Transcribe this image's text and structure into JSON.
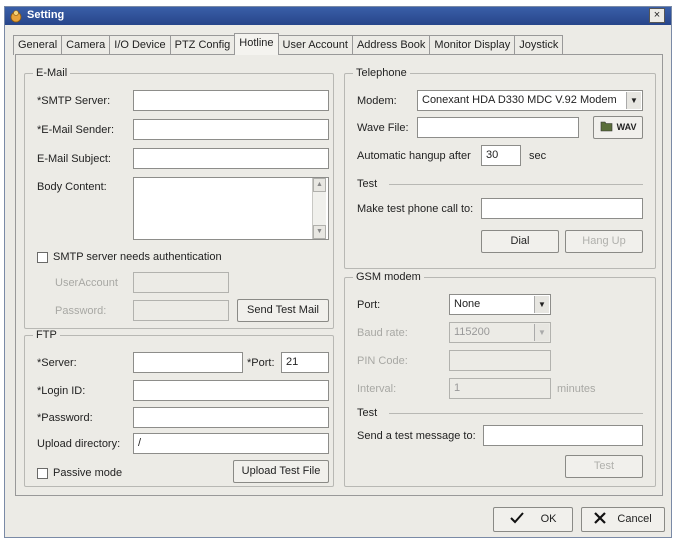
{
  "window": {
    "title": "Setting",
    "close_glyph": "×"
  },
  "tabs": [
    {
      "label": "General"
    },
    {
      "label": "Camera"
    },
    {
      "label": "I/O Device"
    },
    {
      "label": "PTZ Config"
    },
    {
      "label": "Hotline"
    },
    {
      "label": "User Account"
    },
    {
      "label": "Address Book"
    },
    {
      "label": "Monitor Display"
    },
    {
      "label": "Joystick"
    }
  ],
  "active_tab": "Hotline",
  "email": {
    "legend": "E-Mail",
    "smtp_server_label": "*SMTP Server:",
    "smtp_server_value": "",
    "sender_label": "*E-Mail Sender:",
    "sender_value": "",
    "subject_label": "E-Mail Subject:",
    "subject_value": "",
    "body_label": "Body Content:",
    "body_value": "",
    "auth_checkbox_label": "SMTP server needs authentication",
    "auth_checked": false,
    "useraccount_label": "UserAccount",
    "useraccount_value": "",
    "password_label": "Password:",
    "password_value": "",
    "send_test_mail": "Send Test Mail"
  },
  "ftp": {
    "legend": "FTP",
    "server_label": "*Server:",
    "server_value": "",
    "port_label": "*Port:",
    "port_value": "21",
    "login_label": "*Login ID:",
    "login_value": "",
    "password_label": "*Password:",
    "password_value": "",
    "upload_dir_label": "Upload directory:",
    "upload_dir_value": "/",
    "passive_label": "Passive mode",
    "passive_checked": false,
    "upload_test_file": "Upload Test File"
  },
  "telephone": {
    "legend": "Telephone",
    "modem_label": "Modem:",
    "modem_value": "Conexant HDA D330 MDC V.92 Modem",
    "wave_file_label": "Wave File:",
    "wave_file_value": "",
    "wave_browse_label": "WAV",
    "hangup_label": "Automatic hangup after",
    "hangup_value": "30",
    "hangup_unit": "sec",
    "test_heading": "Test",
    "test_call_label": "Make test phone call to:",
    "test_call_value": "",
    "dial": "Dial",
    "hang_up": "Hang Up"
  },
  "gsm": {
    "legend": "GSM modem",
    "port_label": "Port:",
    "port_value": "None",
    "baud_label": "Baud rate:",
    "baud_value": "115200",
    "pin_label": "PIN Code:",
    "pin_value": "",
    "interval_label": "Interval:",
    "interval_value": "1",
    "interval_unit": "minutes",
    "test_heading": "Test",
    "test_msg_label": "Send a test message to:",
    "test_msg_value": "",
    "test_button": "Test"
  },
  "footer": {
    "ok": "OK",
    "cancel": "Cancel"
  },
  "icons": {
    "title_icon": "app-settings-icon",
    "ok_icon": "checkmark-icon",
    "cancel_icon": "x-icon",
    "wav_icon": "folder-icon"
  }
}
